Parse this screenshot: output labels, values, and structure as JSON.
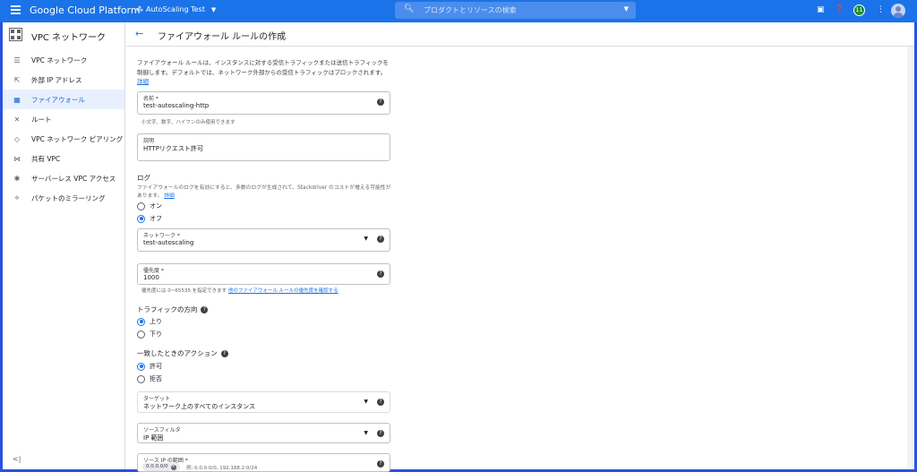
{
  "topbar": {
    "brand": "Google Cloud Platform",
    "project": "AutoScaling Test",
    "search_placeholder": "プロダクトとリソースの検索",
    "badge": "11",
    "icons": [
      "menu-icon",
      "project-icon",
      "search-icon",
      "cloud-shell-icon",
      "help-icon",
      "notification-badge",
      "more-vert-icon",
      "account-avatar-icon"
    ]
  },
  "sidebar": {
    "title": "VPC ネットワーク",
    "items": [
      {
        "label": "VPC ネットワーク",
        "icon": "vpc-network-icon"
      },
      {
        "label": "外部 IP アドレス",
        "icon": "external-ip-icon"
      },
      {
        "label": "ファイアウォール",
        "icon": "firewall-icon"
      },
      {
        "label": "ルート",
        "icon": "routes-icon"
      },
      {
        "label": "VPC ネットワーク ピアリング",
        "icon": "peering-icon"
      },
      {
        "label": "共有 VPC",
        "icon": "shared-vpc-icon"
      },
      {
        "label": "サーバーレス VPC アクセス",
        "icon": "serverless-icon"
      },
      {
        "label": "パケットのミラーリング",
        "icon": "mirroring-icon"
      }
    ],
    "active_index": 2
  },
  "page": {
    "title": "ファイアウォール ルールの作成",
    "intro": "ファイアウォール ルールは、インスタンスに対する受信トラフィックまたは送信トラフィックを制御します。デフォルトでは、ネットワーク外部からの受信トラフィックはブロックされます。",
    "intro_link": "詳細"
  },
  "form": {
    "name_label": "名前 *",
    "name_value": "test-autoscaling-http",
    "name_hint": "小文字、数字、ハイフンのみ使用できます",
    "desc_label": "説明",
    "desc_value": "HTTPリクエスト許可",
    "log_heading": "ログ",
    "log_text": "ファイアウォールのログを有効にすると、多数のログが生成されて、Stackdriver のコストが増える可能性があります。",
    "log_link": "詳細",
    "log_on": "オン",
    "log_off": "オフ",
    "network_label": "ネットワーク *",
    "network_value": "test-autoscaling",
    "priority_label": "優先度 *",
    "priority_value": "1000",
    "priority_hint": "優先度には 0~65535 を指定できます",
    "priority_link": "他のファイアウォール ルールの優先度を確認する",
    "direction_heading": "トラフィックの方向",
    "dir_in": "上り",
    "dir_out": "下り",
    "action_heading": "一致したときのアクション",
    "act_allow": "許可",
    "act_deny": "拒否",
    "target_label": "ターゲット",
    "target_value": "ネットワーク上のすべてのインスタンス",
    "filter_label": "ソースフィルタ",
    "filter_value": "IP 範囲",
    "range_label": "ソース IP の範囲 *",
    "range_chip": "0.0.0.0/0",
    "range_example": "例: 0.0.0.0/0, 192.168.2.0/24"
  }
}
